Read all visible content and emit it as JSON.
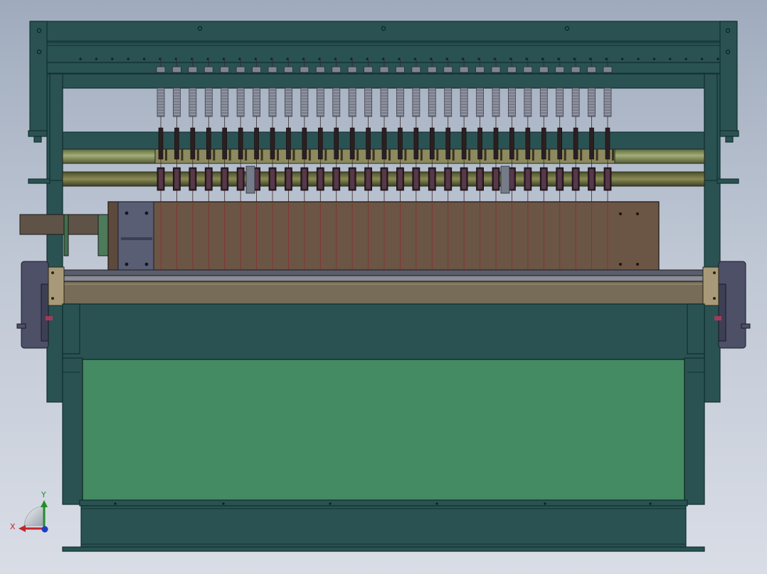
{
  "view": {
    "background_top": "#9fabbd",
    "background_bottom": "#d9dde6"
  },
  "model": {
    "frame_color": "#2a5252",
    "frame_edge": "#123030",
    "bed_color": "#448a62",
    "plate_color": "#6b5545",
    "rail_color": "#766c57",
    "roller_color": "#7f8a5a",
    "spring_color": "#8f93a1",
    "bracket_color": "#5a5e74",
    "needle_color": "#8b2e2e",
    "tool_count": 29
  },
  "triad": {
    "x_label": "X",
    "y_label": "Y",
    "x_color": "#c0272d",
    "y_color": "#1f8f2a",
    "z_color": "#1f3fbf"
  }
}
